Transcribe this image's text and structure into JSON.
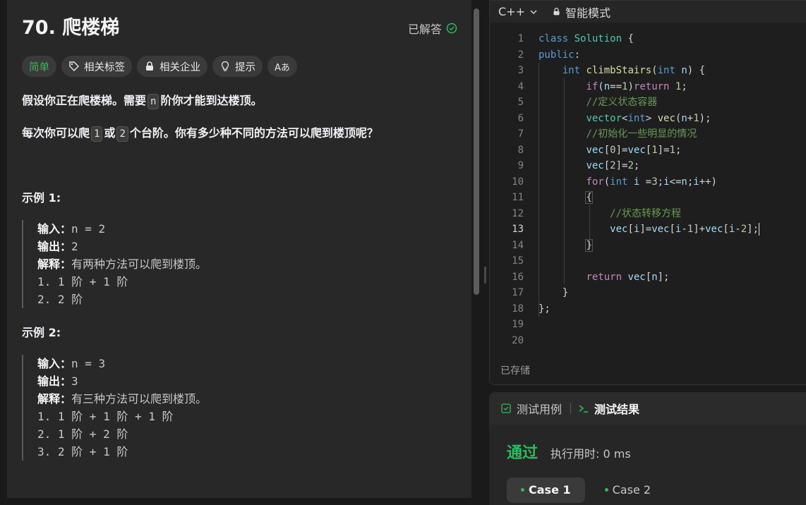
{
  "problem": {
    "title": "70. 爬楼梯",
    "status": "已解答",
    "tags": [
      "简单",
      "相关标签",
      "相关企业",
      "提示",
      "Aあ"
    ],
    "desc1_before": "假设你正在爬楼梯。需要",
    "desc1_code": "n",
    "desc1_after": "阶你才能到达楼顶。",
    "desc2_before": "每次你可以爬",
    "desc2_code1": "1",
    "desc2_mid": "或",
    "desc2_code2": "2",
    "desc2_after": "个台阶。你有多少种不同的方法可以爬到楼顶呢？",
    "examples": [
      {
        "title": "示例 1:",
        "input_label": "输入：",
        "input": "n = 2",
        "output_label": "输出：",
        "output": "2",
        "explain_label": "解释：",
        "explain": "有两种方法可以爬到楼顶。",
        "steps": [
          "1. 1 阶 + 1 阶",
          "2. 2 阶"
        ]
      },
      {
        "title": "示例 2:",
        "input_label": "输入：",
        "input": "n = 3",
        "output_label": "输出：",
        "output": "3",
        "explain_label": "解释：",
        "explain": "有三种方法可以爬到楼顶。",
        "steps": [
          "1. 1 阶 + 1 阶 + 1 阶",
          "2. 1 阶 + 2 阶",
          "3. 2 阶 + 1 阶"
        ]
      }
    ]
  },
  "editor": {
    "language": "C++",
    "mode": "智能模式",
    "saved": "已存储",
    "line_numbers": [
      "1",
      "2",
      "3",
      "4",
      "5",
      "6",
      "7",
      "8",
      "9",
      "10",
      "11",
      "12",
      "13",
      "14",
      "15",
      "16",
      "17",
      "18",
      "19",
      "20"
    ]
  },
  "results": {
    "tab_testcase": "测试用例",
    "tab_result": "测试结果",
    "status": "通过",
    "runtime": "执行用时: 0 ms",
    "cases": [
      "Case 1",
      "Case 2"
    ]
  },
  "colors": {
    "easy_green": "#2cbb5d",
    "panel": "#282828"
  }
}
